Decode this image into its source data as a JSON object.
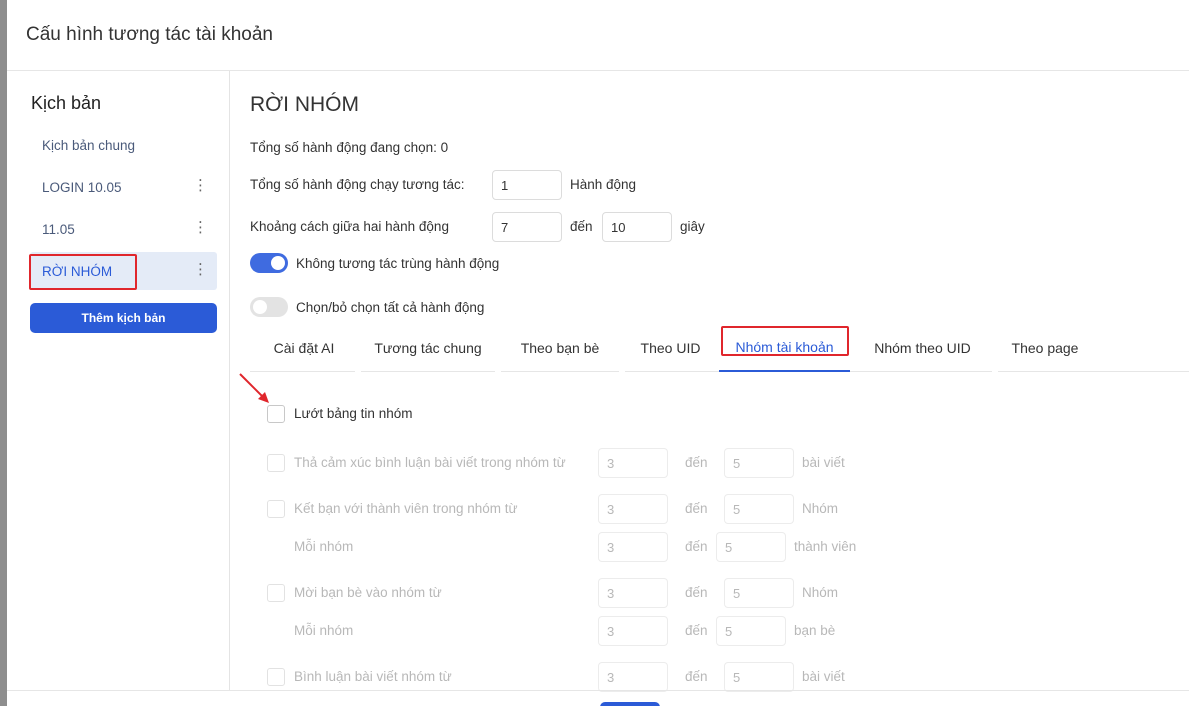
{
  "dialog": {
    "title": "Cấu hình tương tác tài khoản"
  },
  "sidebar": {
    "heading": "Kịch bản",
    "items": [
      {
        "label": "Kịch bản chung",
        "has_menu": false
      },
      {
        "label": "LOGIN 10.05",
        "has_menu": true
      },
      {
        "label": "11.05",
        "has_menu": true
      },
      {
        "label": "RỜI NHÓM",
        "has_menu": true,
        "active": true
      }
    ],
    "menu_glyph": "⋮",
    "add_button": "Thêm kịch bản"
  },
  "main": {
    "title": "RỜI NHÓM",
    "total_selected": "Tổng số hành động đang chọn: 0",
    "total_run_label": "Tổng số hành động chạy tương tác:",
    "total_run_value": "1",
    "total_run_unit": "Hành động",
    "interval_label": "Khoảng cách giữa hai hành động",
    "interval_from": "7",
    "interval_to_word": "đến",
    "interval_to": "10",
    "interval_unit": "giây",
    "toggle_no_repeat": {
      "label": "Không tương tác trùng hành động",
      "on": true
    },
    "toggle_select_all": {
      "label": "Chọn/bỏ chọn tất cả hành động",
      "on": false
    }
  },
  "tabs": [
    {
      "label": "Cài đặt AI"
    },
    {
      "label": "Tương tác chung"
    },
    {
      "label": "Theo bạn bè"
    },
    {
      "label": "Theo UID"
    },
    {
      "label": "Nhóm tài khoản",
      "active": true
    },
    {
      "label": "Nhóm theo UID"
    },
    {
      "label": "Theo page"
    }
  ],
  "options": {
    "feed": {
      "label": "Lướt bảng tin nhóm"
    },
    "react": {
      "label": "Thả cảm xúc bình luận bài viết trong nhóm từ",
      "from": "3",
      "to_word": "đến",
      "to": "5",
      "unit": "bài viết"
    },
    "friend": {
      "label": "Kết bạn với thành viên trong nhóm từ",
      "from": "3",
      "to_word": "đến",
      "to": "5",
      "unit": "Nhóm"
    },
    "friend_each": {
      "label": "Mỗi nhóm",
      "from": "3",
      "to_word": "đến",
      "to": "5",
      "unit": "thành viên"
    },
    "invite": {
      "label": "Mời bạn bè vào nhóm từ",
      "from": "3",
      "to_word": "đến",
      "to": "5",
      "unit": "Nhóm"
    },
    "invite_each": {
      "label": "Mỗi nhóm",
      "from": "3",
      "to_word": "đến",
      "to": "5",
      "unit": "bạn bè"
    },
    "comment": {
      "label": "Bình luận bài viết nhóm từ",
      "from": "3",
      "to_word": "đến",
      "to": "5",
      "unit": "bài viết"
    }
  },
  "colors": {
    "accent": "#2b5bd7",
    "highlight": "#e0262c"
  }
}
